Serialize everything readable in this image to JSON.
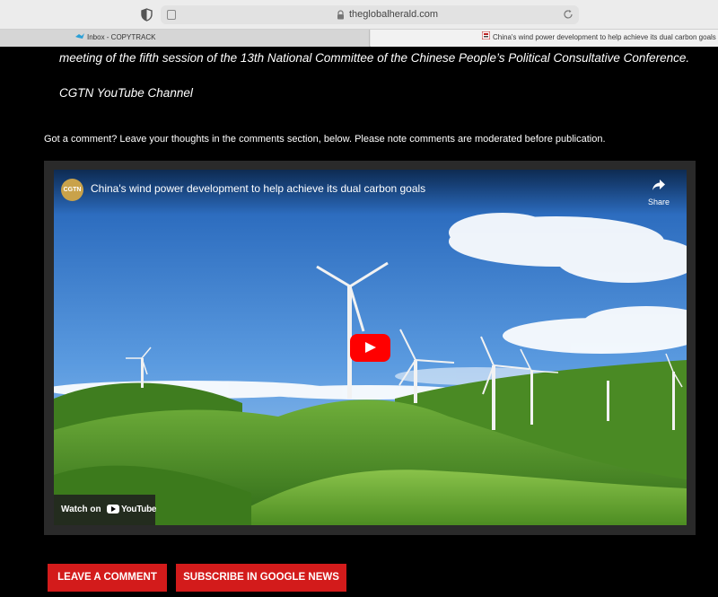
{
  "browser": {
    "url": "theglobalherald.com",
    "tabs": [
      {
        "label": "Inbox - COPYTRACK"
      },
      {
        "label": "China's wind power development to help achieve its dual carbon goals -"
      }
    ],
    "icons": [
      "shield-icon",
      "reader-icon",
      "lock-icon",
      "reload-icon"
    ]
  },
  "article": {
    "intro": "meeting of the fifth session of the 13th National Committee of the Chinese People’s Political Consultative Conference.",
    "source": "CGTN YouTube Channel",
    "comment_note": "Got a comment? Leave your thoughts in the comments section, below. Please note comments are moderated before publication."
  },
  "video": {
    "channel_logo": "CGTN",
    "title": "China's wind power development to help achieve its dual carbon goals",
    "share_label": "Share",
    "watch_on": "Watch on",
    "platform": "YouTube"
  },
  "buttons": {
    "leave_comment": "LEAVE A COMMENT",
    "subscribe": "SUBSCRIBE IN GOOGLE NEWS"
  },
  "colors": {
    "accent": "#d31b1b",
    "play": "#ff0000",
    "page_bg": "#000000"
  }
}
